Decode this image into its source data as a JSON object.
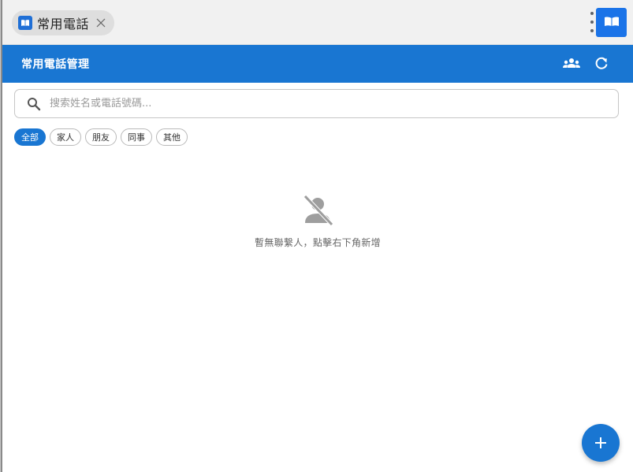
{
  "browser": {
    "tab_title": "常用電話",
    "close_icon": "close-icon",
    "menu_icon": "more-vert-icon",
    "extension_icon": "book-icon"
  },
  "header": {
    "title": "常用電話管理",
    "actions": [
      {
        "icon": "groups-icon"
      },
      {
        "icon": "refresh-icon"
      }
    ]
  },
  "search": {
    "placeholder": "搜索姓名或電話號碼...",
    "value": "",
    "icon": "search-icon"
  },
  "filters": {
    "items": [
      {
        "label": "全部",
        "active": true
      },
      {
        "label": "家人",
        "active": false
      },
      {
        "label": "朋友",
        "active": false
      },
      {
        "label": "同事",
        "active": false
      },
      {
        "label": "其他",
        "active": false
      }
    ]
  },
  "empty_state": {
    "icon": "person-off-icon",
    "message": "暫無聯繫人，點擊右下角新增"
  },
  "fab": {
    "icon": "add-icon"
  },
  "colors": {
    "primary": "#1976d2",
    "extension": "#1a73e8",
    "muted_icon": "#9e9e9e"
  }
}
